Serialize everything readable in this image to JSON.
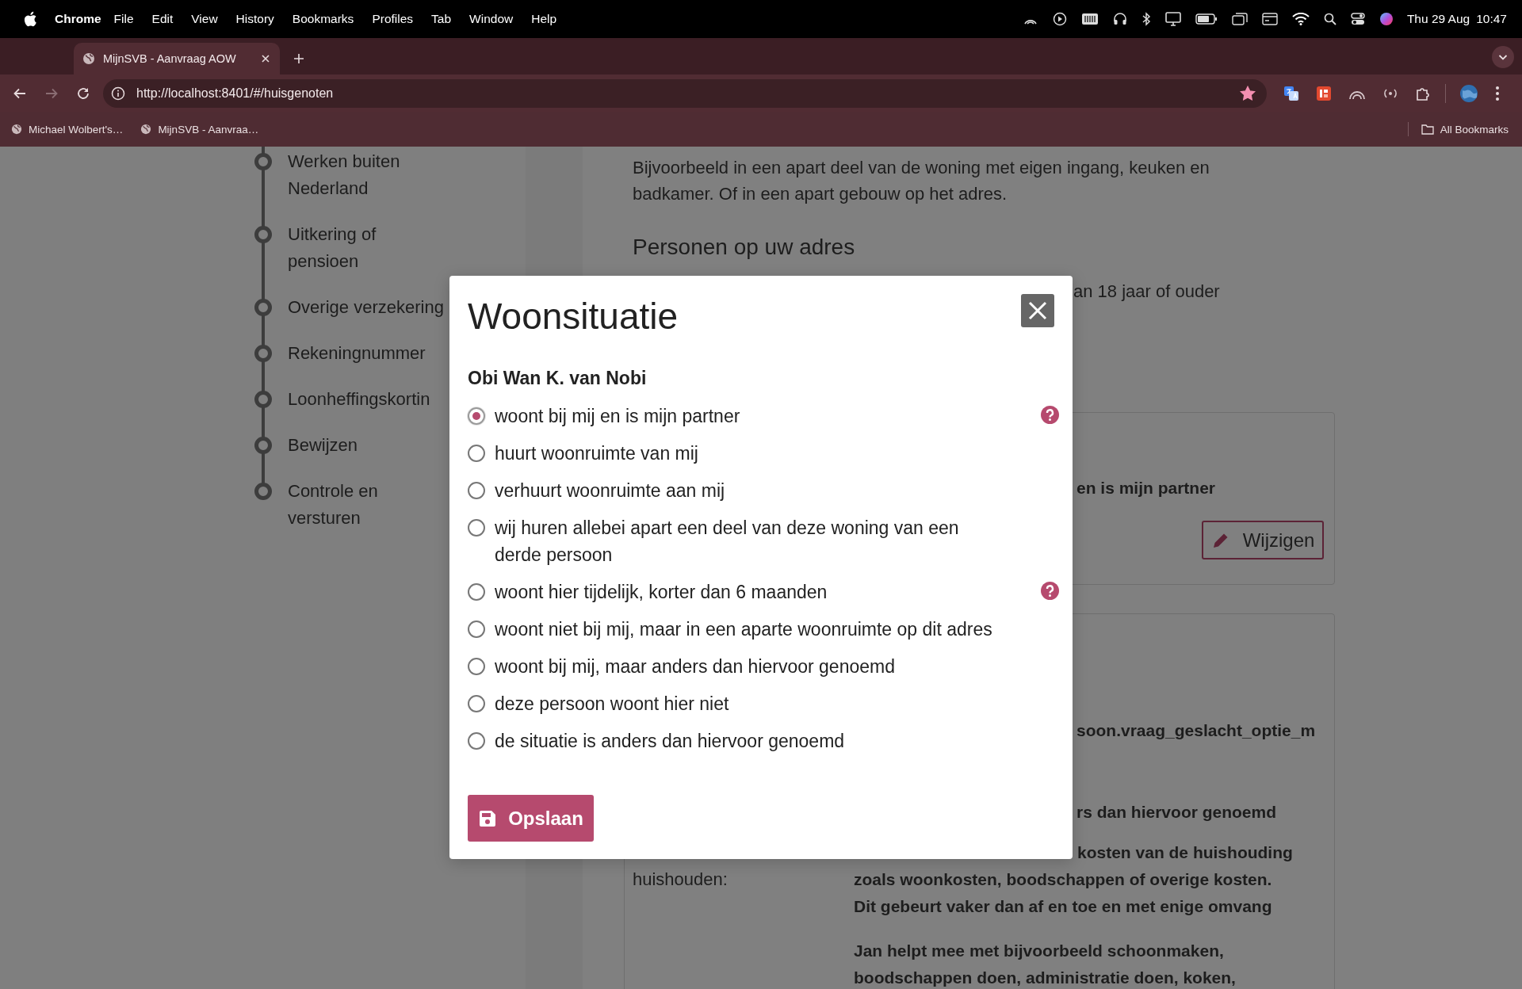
{
  "menu_bar": {
    "app_name": "Chrome",
    "menus": [
      "File",
      "Edit",
      "View",
      "History",
      "Bookmarks",
      "Profiles",
      "Tab",
      "Window",
      "Help"
    ],
    "date": "Thu 29 Aug",
    "time": "10:47"
  },
  "browser": {
    "tabs": [
      {
        "title": "MijnSVB - Aanvraag AOW",
        "selected": true
      }
    ],
    "forward_disabled": true,
    "url": "http://localhost:8401/#/huisgenoten",
    "bookmarked": true,
    "bookmarks": [
      "Michael Wolbert's…",
      "MijnSVB - Aanvraa…"
    ],
    "all_bookmarks": "All Bookmarks"
  },
  "sidebar": {
    "steps": [
      {
        "lines": [
          "Werken buiten",
          "Nederland"
        ]
      },
      {
        "lines": [
          "Uitkering of",
          "pensioen"
        ]
      },
      {
        "lines": [
          "Overige verzekering"
        ]
      },
      {
        "lines": [
          "Rekeningnummer"
        ]
      },
      {
        "lines": [
          "Loonheffingskortin"
        ]
      },
      {
        "lines": [
          "Bewijzen"
        ]
      },
      {
        "lines": [
          "Controle en",
          "versturen"
        ]
      }
    ]
  },
  "content": {
    "intro": "Bijvoorbeeld in een apart deel van de woning met eigen ingang, keuken en badkamer. Of in een apart gebouw op het adres.",
    "heading": "Personen op uw adres",
    "fragment": "an 18 jaar of ouder",
    "card_1": {
      "answer_fragment": "en is mijn partner",
      "edit_button": "Wijzigen"
    },
    "card_2": {
      "fragments": [
        "soon.vraag_geslacht_optie_m",
        "rs dan hiervoor genoemd"
      ],
      "label": "huishouden:",
      "first_line_fragment": "kosten van de huishouding",
      "lines": [
        "zoals woonkosten, boodschappen of overige kosten.",
        "Dit gebeurt vaker dan af en toe en met enige omvang"
      ],
      "second_paragraph_lines": [
        "Jan helpt mee met bijvoorbeeld schoonmaken,",
        "boodschappen doen, administratie doen, koken,"
      ]
    }
  },
  "dialog": {
    "title": "Woonsituatie",
    "person": "Obi Wan K. van Nobi",
    "options": [
      {
        "label": "woont bij mij en is mijn partner",
        "selected": true,
        "help": true
      },
      {
        "label": "huurt woonruimte van mij",
        "selected": false,
        "help": false
      },
      {
        "label": "verhuurt woonruimte aan mij",
        "selected": false,
        "help": false
      },
      {
        "label": "wij huren allebei apart een deel van deze woning van een derde persoon",
        "selected": false,
        "help": false
      },
      {
        "label": "woont hier tijdelijk, korter dan 6 maanden",
        "selected": false,
        "help": true
      },
      {
        "label": "woont niet bij mij, maar in een aparte woonruimte op dit adres",
        "selected": false,
        "help": false
      },
      {
        "label": "woont bij mij, maar anders dan hiervoor genoemd",
        "selected": false,
        "help": false
      },
      {
        "label": "deze persoon woont hier niet",
        "selected": false,
        "help": false
      },
      {
        "label": "de situatie is anders dan hiervoor genoemd",
        "selected": false,
        "help": false
      }
    ],
    "save_button": "Opslaan"
  }
}
